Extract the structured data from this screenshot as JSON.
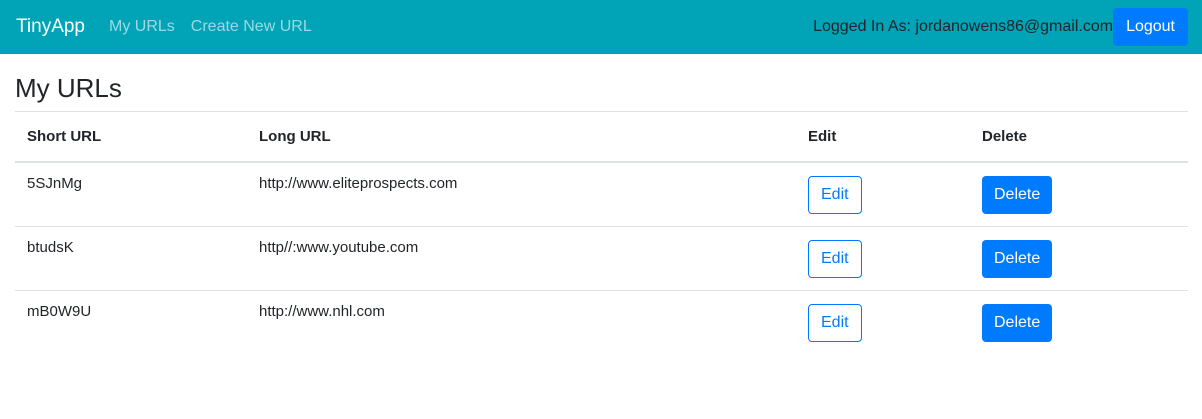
{
  "navbar": {
    "brand": "TinyApp",
    "links": [
      "My URLs",
      "Create New URL"
    ],
    "logged_in_label": "Logged In As: jordanowens86@gmail.com",
    "logout_label": "Logout",
    "color": "#01a3b6"
  },
  "page_title": "My URLs",
  "table": {
    "headers": [
      "Short URL",
      "Long URL",
      "Edit",
      "Delete"
    ],
    "rows": [
      {
        "short": "5SJnMg",
        "long": "http://www.eliteprospects.com",
        "edit": "Edit",
        "delete": "Delete"
      },
      {
        "short": "btudsK",
        "long": "http//:www.youtube.com",
        "edit": "Edit",
        "delete": "Delete"
      },
      {
        "short": "mB0W9U",
        "long": "http://www.nhl.com",
        "edit": "Edit",
        "delete": "Delete"
      }
    ]
  }
}
